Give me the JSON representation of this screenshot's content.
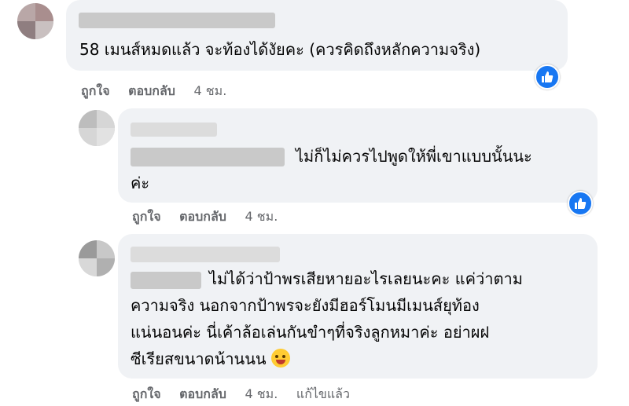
{
  "comments": [
    {
      "text_lines": [
        "58 เมนส์หมดแล้ว จะท้องได้งัยคะ (ควรคิดถึงหลักความจริง)"
      ],
      "actions": {
        "like": "ถูกใจ",
        "reply": "ตอบกลับ",
        "time": "4 ชม."
      }
    },
    {
      "text_lines": [
        "ไม่ก็ไม่ควรไปพูดให้พี่เขาแบบนั้นนะ",
        "ค่ะ"
      ],
      "actions": {
        "like": "ถูกใจ",
        "reply": "ตอบกลับ",
        "time": "4 ชม."
      }
    },
    {
      "text_lines": [
        "ไม่ได้ว่าป้าพรเสียหายอะไรเลยนะคะ แค่ว่าตาม",
        "ความจริง นอกจากป้าพรจะยังมีฮอร์โมนมีเมนส์ยุท้อง",
        "แน่นอนค่ะ นี่เค้าล้อเล่นกันขำๆที่จริงลูกหมาค่ะ อย่าผฝ",
        "ซีเรียสขนาดน้านนน"
      ],
      "actions": {
        "like": "ถูกใจ",
        "reply": "ตอบกลับ",
        "time": "4 ชม.",
        "edited": "แก้ไขแล้ว"
      }
    }
  ],
  "colors": {
    "bubble": "#f0f2f5",
    "meta": "#65676b",
    "like_badge": "#1877f2"
  },
  "icons": {
    "reaction": "thumbs-up-icon",
    "emoji": "laughing-tongue-emoji"
  }
}
